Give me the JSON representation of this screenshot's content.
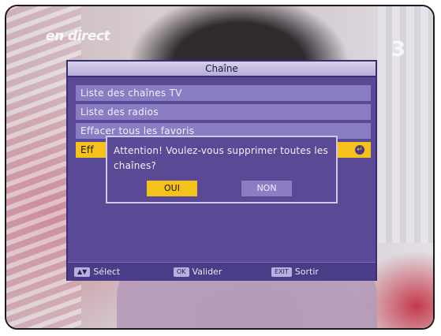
{
  "broadcast": {
    "live_label": "en direct",
    "channel_logo": "3"
  },
  "osd": {
    "title": "Chaîne",
    "menu_items": [
      {
        "label": "Liste des chaînes TV"
      },
      {
        "label": "Liste des radios"
      },
      {
        "label": "Effacer tous les favoris"
      },
      {
        "label": "Eff",
        "selected": true,
        "icon": "enter-icon"
      }
    ],
    "accent_color": "#f4c21a",
    "panel_color": "#5a4a96"
  },
  "dialog": {
    "message": "Attention! Voulez-vous supprimer toutes les chaînes?",
    "yes_label": "OUI",
    "no_label": "NON"
  },
  "footer": {
    "select_label": "Sélect",
    "ok_key": "OK",
    "validate_label": "Valider",
    "exit_key": "EXIT",
    "exit_label": "Sortir"
  }
}
